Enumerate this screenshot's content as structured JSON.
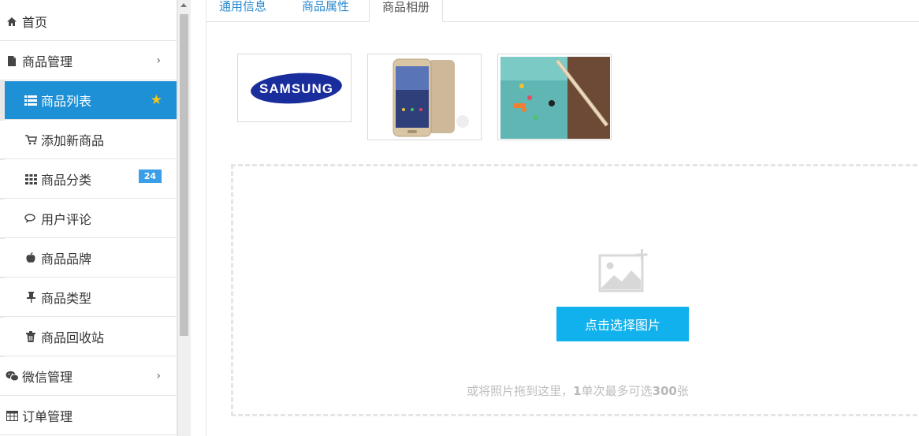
{
  "sidebar": {
    "items": [
      {
        "label": "首页",
        "icon": "home-icon"
      },
      {
        "label": "商品管理",
        "icon": "file-icon"
      },
      {
        "label": "商品列表",
        "icon": "list-icon"
      },
      {
        "label": "添加新商品",
        "icon": "cart-icon"
      },
      {
        "label": "商品分类",
        "icon": "grid-icon",
        "badge": "24"
      },
      {
        "label": "用户评论",
        "icon": "comments-icon"
      },
      {
        "label": "商品品牌",
        "icon": "apple-icon"
      },
      {
        "label": "商品类型",
        "icon": "pin-icon"
      },
      {
        "label": "商品回收站",
        "icon": "trash-icon"
      },
      {
        "label": "微信管理",
        "icon": "wechat-icon"
      },
      {
        "label": "订单管理",
        "icon": "table-icon"
      }
    ]
  },
  "tabs": [
    {
      "label": "通用信息"
    },
    {
      "label": "商品属性"
    },
    {
      "label": "商品相册"
    }
  ],
  "gallery": {
    "samsung_logo_text": "SAMSUNG",
    "upload_button": "点击选择图片",
    "hint_prefix": "或将照片拖到这里，",
    "hint_num1": "1",
    "hint_mid": "单次最多可选",
    "hint_num2": "300",
    "hint_suffix": "张"
  },
  "colors": {
    "active_menu": "#1e90d6",
    "accent_button": "#10b1ec",
    "badge": "#3a9ee8",
    "tab_link": "#2a8bd0"
  }
}
